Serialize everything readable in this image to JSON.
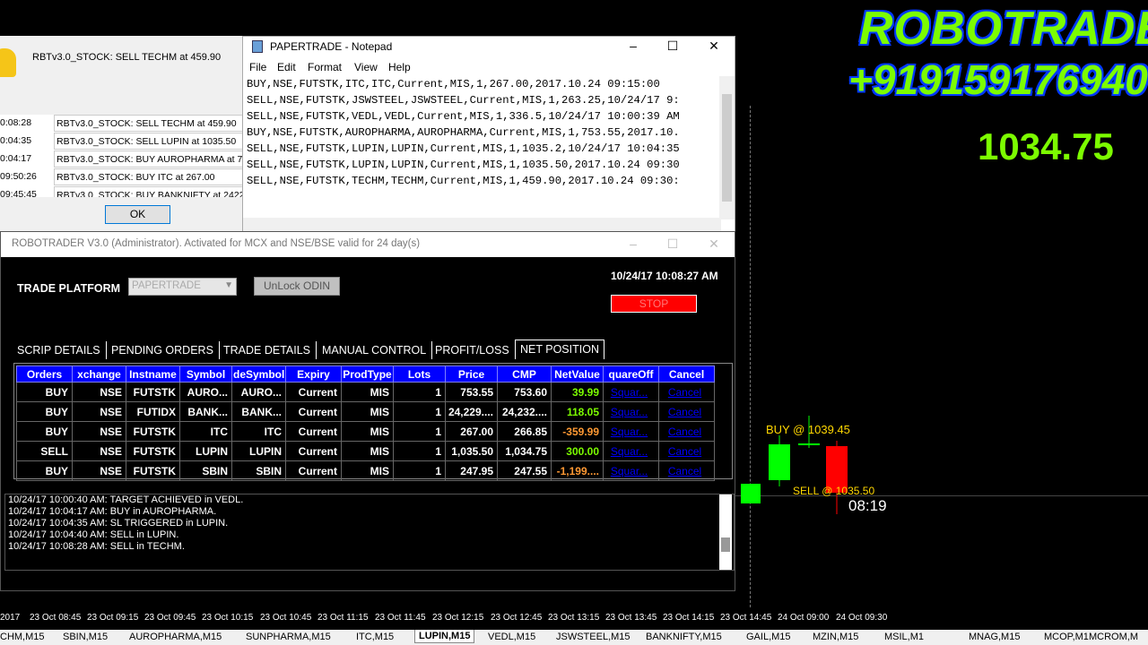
{
  "watermark": {
    "line1": "ROBOTRADER",
    "line2": "+919159176940"
  },
  "chart": {
    "current_price": "1034.75",
    "buy_marker": "BUY @ 1039.45",
    "sell_marker": "SELL @ 1035.50",
    "countdown": "08:19",
    "time_axis": [
      "2017",
      "23 Oct 08:45",
      "23 Oct 09:15",
      "23 Oct 09:45",
      "23 Oct 10:15",
      "23 Oct 10:45",
      "23 Oct 11:15",
      "23 Oct 11:45",
      "23 Oct 12:15",
      "23 Oct 12:45",
      "23 Oct 13:15",
      "23 Oct 13:45",
      "23 Oct 14:15",
      "23 Oct 14:45",
      "24 Oct 09:00",
      "24 Oct 09:30"
    ],
    "colors": {
      "bull": "#00ff00",
      "bear": "#ff0000",
      "price": "#7CFC00"
    }
  },
  "symbol_tabs": {
    "items": [
      "CHM,M15",
      "SBIN,M15",
      "AUROPHARMA,M15",
      "SUNPHARMA,M15",
      "ITC,M15",
      "LUPIN,M15",
      "VEDL,M15",
      "JSWSTEEL,M15",
      "BANKNIFTY,M15",
      "GAIL,M15",
      "MZIN,M15",
      "MSIL,M1",
      "MNAG,M15",
      "MCOP,M1",
      "MCROM,M"
    ],
    "active": "LUPIN,M15"
  },
  "alert": {
    "message": "RBTv3.0_STOCK: SELL TECHM at 459.90",
    "rows": [
      {
        "time": "0:08:28",
        "msg": "RBTv3.0_STOCK: SELL TECHM at 459.90"
      },
      {
        "time": "0:04:35",
        "msg": "RBTv3.0_STOCK: SELL LUPIN at 1035.50"
      },
      {
        "time": "0:04:17",
        "msg": "RBTv3.0_STOCK: BUY  AUROPHARMA at 7"
      },
      {
        "time": "09:50:26",
        "msg": "RBTv3.0_STOCK: BUY  ITC at 267.00"
      },
      {
        "time": "09:45:45",
        "msg": "RBTv3.0_STOCK: BUY  BANKNIFTY at 2422"
      }
    ],
    "ok_label": "OK"
  },
  "notepad": {
    "title": "PAPERTRADE - Notepad",
    "menu": [
      "File",
      "Edit",
      "Format",
      "View",
      "Help"
    ],
    "lines": [
      "BUY,NSE,FUTSTK,ITC,ITC,Current,MIS,1,267.00,2017.10.24 09:15:00",
      "SELL,NSE,FUTSTK,JSWSTEEL,JSWSTEEL,Current,MIS,1,263.25,10/24/17 9:",
      "SELL,NSE,FUTSTK,VEDL,VEDL,Current,MIS,1,336.5,10/24/17 10:00:39 AM",
      "BUY,NSE,FUTSTK,AUROPHARMA,AUROPHARMA,Current,MIS,1,753.55,2017.10.",
      "SELL,NSE,FUTSTK,LUPIN,LUPIN,Current,MIS,1,1035.2,10/24/17 10:04:35",
      "SELL,NSE,FUTSTK,LUPIN,LUPIN,Current,MIS,1,1035.50,2017.10.24 09:30",
      "SELL,NSE,FUTSTK,TECHM,TECHM,Current,MIS,1,459.90,2017.10.24 09:30:"
    ]
  },
  "robotrader": {
    "title": "ROBOTRADER V3.0 (Administrator). Activated for MCX and NSE/BSE valid for 24 day(s)",
    "platform_label": "TRADE PLATFORM",
    "platform_value": "PAPERTRADE",
    "unlock_label": "UnLock ODIN",
    "datetime": "10/24/17 10:08:27 AM",
    "stop_label": "STOP",
    "tabs": [
      "SCRIP DETAILS",
      "PENDING ORDERS",
      "TRADE DETAILS",
      "MANUAL CONTROL",
      "PROFIT/LOSS",
      "NET POSITION"
    ],
    "active_tab": "NET POSITION",
    "columns": [
      "Orders",
      "Exchange",
      "Instname",
      "Symbol",
      "TradeSymbol",
      "Expiry",
      "ProdType",
      "Lots",
      "Price",
      "CMP",
      "NetValue",
      "SquareOff",
      "Cancel"
    ],
    "column_display": [
      "Orders",
      "xchange",
      "Instname",
      "Symbol",
      "deSymbol",
      "Expiry",
      "ProdType",
      "Lots",
      "Price",
      "CMP",
      "NetValue",
      "quareOff",
      "Cancel"
    ],
    "rows": [
      {
        "order": "BUY",
        "exchange": "NSE",
        "inst": "FUTSTK",
        "symbol": "AURO...",
        "tsymbol": "AURO...",
        "expiry": "Current",
        "prod": "MIS",
        "lots": "1",
        "price": "753.55",
        "cmp": "753.60",
        "net": "39.99",
        "net_color": "green",
        "sq": "Squar...",
        "cancel": "Cancel"
      },
      {
        "order": "BUY",
        "exchange": "NSE",
        "inst": "FUTIDX",
        "symbol": "BANK...",
        "tsymbol": "BANK...",
        "expiry": "Current",
        "prod": "MIS",
        "lots": "1",
        "price": "24,229....",
        "cmp": "24,232....",
        "net": "118.05",
        "net_color": "green",
        "sq": "Squar...",
        "cancel": "Cancel"
      },
      {
        "order": "BUY",
        "exchange": "NSE",
        "inst": "FUTSTK",
        "symbol": "ITC",
        "tsymbol": "ITC",
        "expiry": "Current",
        "prod": "MIS",
        "lots": "1",
        "price": "267.00",
        "cmp": "266.85",
        "net": "-359.99",
        "net_color": "orange",
        "sq": "Squar...",
        "cancel": "Cancel"
      },
      {
        "order": "SELL",
        "exchange": "NSE",
        "inst": "FUTSTK",
        "symbol": "LUPIN",
        "tsymbol": "LUPIN",
        "expiry": "Current",
        "prod": "MIS",
        "lots": "1",
        "price": "1,035.50",
        "cmp": "1,034.75",
        "net": "300.00",
        "net_color": "green",
        "sq": "Squar...",
        "cancel": "Cancel"
      },
      {
        "order": "BUY",
        "exchange": "NSE",
        "inst": "FUTSTK",
        "symbol": "SBIN",
        "tsymbol": "SBIN",
        "expiry": "Current",
        "prod": "MIS",
        "lots": "1",
        "price": "247.95",
        "cmp": "247.55",
        "net": "-1,199....",
        "net_color": "orange",
        "sq": "Squar...",
        "cancel": "Cancel"
      }
    ],
    "log": [
      "10/24/17 10:00:40 AM: TARGET ACHIEVED in VEDL.",
      "10/24/17 10:04:17 AM: BUY in AUROPHARMA.",
      "10/24/17 10:04:35 AM: SL TRIGGERED in LUPIN.",
      "10/24/17 10:04:40 AM: SELL in LUPIN.",
      "10/24/17 10:08:28 AM: SELL in TECHM."
    ]
  }
}
